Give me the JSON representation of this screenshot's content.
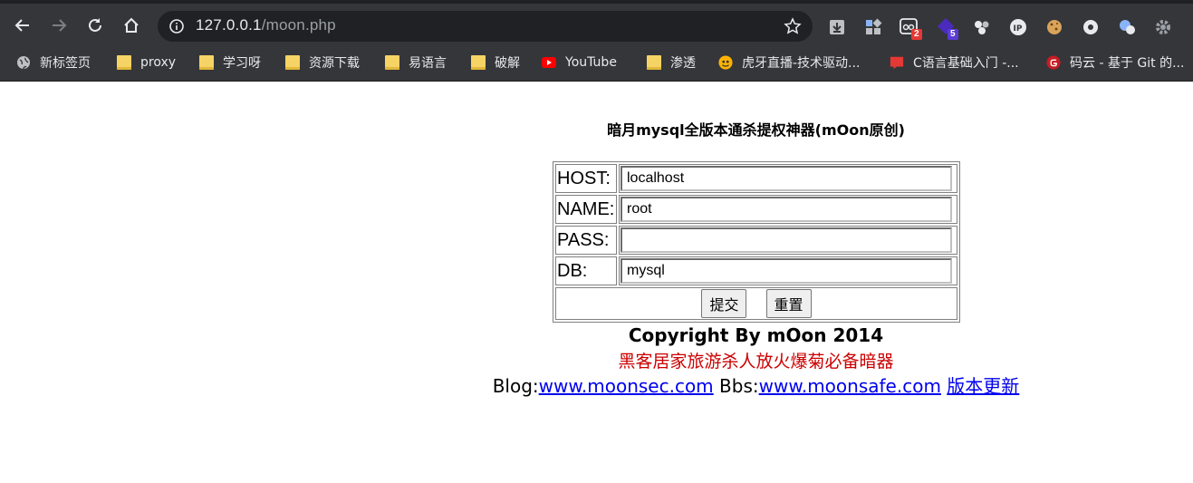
{
  "browser": {
    "url_host": "127.0.0.1",
    "url_path": "/moon.php",
    "extension_badges": [
      "2",
      "5"
    ]
  },
  "bookmarks": [
    {
      "label": "新标签页",
      "icon": "globe-icon"
    },
    {
      "label": "proxy",
      "icon": "folder-icon"
    },
    {
      "label": "学习呀",
      "icon": "folder-icon"
    },
    {
      "label": "资源下载",
      "icon": "folder-icon"
    },
    {
      "label": "易语言",
      "icon": "folder-icon"
    },
    {
      "label": "破解",
      "icon": "folder-icon"
    },
    {
      "label": "YouTube",
      "icon": "youtube-icon"
    },
    {
      "label": "渗透",
      "icon": "folder-icon"
    },
    {
      "label": "虎牙直播-技术驱动...",
      "icon": "huya-icon"
    },
    {
      "label": "C语言基础入门 -...",
      "icon": "red-book-icon"
    },
    {
      "label": "码云 - 基于 Git 的...",
      "icon": "gitee-icon"
    }
  ],
  "page": {
    "title": "暗月mysql全版本通杀提权神器(mOon原创)",
    "form": {
      "host_label": "HOST:",
      "host_value": "localhost",
      "name_label": "NAME:",
      "name_value": "root",
      "pass_label": "PASS:",
      "pass_value": "",
      "db_label": "DB:",
      "db_value": "mysql",
      "submit_label": "提交",
      "reset_label": "重置"
    },
    "copyright": "Copyright By mOon 2014",
    "slogan": "黑客居家旅游杀人放火爆菊必备暗器",
    "blog_prefix": "Blog:",
    "blog_link": "www.moonsec.com",
    "bbs_prefix": "Bbs:",
    "bbs_link": "www.moonsafe.com",
    "update_link": "版本更新"
  }
}
